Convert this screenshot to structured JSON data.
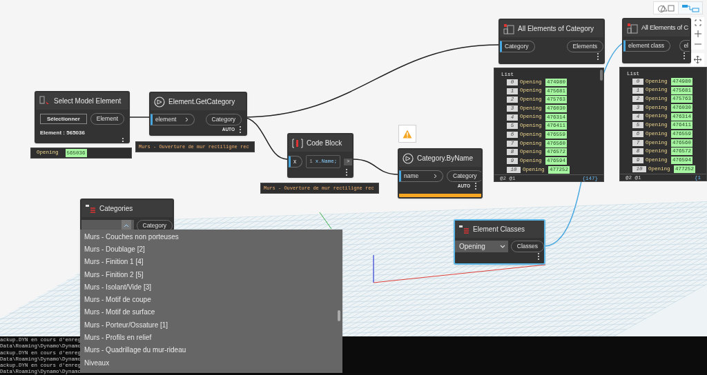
{
  "view_buttons": [
    {
      "kind": "geometry",
      "selected": false
    },
    {
      "kind": "graph",
      "selected": true
    }
  ],
  "nodes": [
    {
      "kind": "select",
      "title": "Select Model Element",
      "selected": false,
      "button": "Sélectionner",
      "outputs": [
        "Element"
      ],
      "info": "Element : 565036",
      "preview": {
        "kind": "item",
        "label": "Opening",
        "value": "565036"
      }
    },
    {
      "kind": "function",
      "title": "Element.GetCategory",
      "selected": false,
      "inputs": [
        "element"
      ],
      "outputs": [
        "Category"
      ],
      "lacing": "AUTO",
      "preview": {
        "kind": "text",
        "text": "Murs - Ouverture de mur rectiligne rec"
      }
    },
    {
      "kind": "code",
      "title": "Code Block",
      "selected": false,
      "inputs": [
        "x"
      ],
      "line": "1",
      "code": "x.Name;",
      "outputs": [
        ">"
      ],
      "preview": {
        "kind": "text",
        "text": "Murs - Ouverture de mur rectiligne rec"
      }
    },
    {
      "kind": "function",
      "title": "Category.ByName",
      "selected": false,
      "warning": true,
      "inputs": [
        "name"
      ],
      "outputs": [
        "Category"
      ],
      "lacing": "AUTO"
    },
    {
      "kind": "query",
      "title": "All Elements of Category",
      "selected": false,
      "inputs": [
        "Category"
      ],
      "outputs": [
        "Elements"
      ],
      "preview": {
        "kind": "list",
        "header": "List",
        "levels": "@2 @1",
        "count": "{147}",
        "rows": [
          {
            "index": "0",
            "label": "Opening",
            "value": "474980"
          },
          {
            "index": "1",
            "label": "Opening",
            "value": "475681"
          },
          {
            "index": "2",
            "label": "Opening",
            "value": "475763"
          },
          {
            "index": "3",
            "label": "Opening",
            "value": "476030"
          },
          {
            "index": "4",
            "label": "Opening",
            "value": "476314"
          },
          {
            "index": "5",
            "label": "Opening",
            "value": "476411"
          },
          {
            "index": "6",
            "label": "Opening",
            "value": "476559"
          },
          {
            "index": "7",
            "label": "Opening",
            "value": "476560"
          },
          {
            "index": "8",
            "label": "Opening",
            "value": "476572"
          },
          {
            "index": "9",
            "label": "Opening",
            "value": "476594"
          },
          {
            "index": "10",
            "label": "Opening",
            "value": "477252"
          }
        ]
      }
    },
    {
      "kind": "query",
      "title": "All Elements of C",
      "selected": false,
      "inputs": [
        "element class"
      ],
      "outputs": [
        "el"
      ],
      "preview": {
        "kind": "list",
        "header": "List",
        "levels": "@2 @1",
        "count": "{1",
        "rows": [
          {
            "index": "0",
            "label": "Opening",
            "value": "474980"
          },
          {
            "index": "1",
            "label": "Opening",
            "value": "475681"
          },
          {
            "index": "2",
            "label": "Opening",
            "value": "475763"
          },
          {
            "index": "3",
            "label": "Opening",
            "value": "476030"
          },
          {
            "index": "4",
            "label": "Opening",
            "value": "476314"
          },
          {
            "index": "5",
            "label": "Opening",
            "value": "476411"
          },
          {
            "index": "6",
            "label": "Opening",
            "value": "476559"
          },
          {
            "index": "7",
            "label": "Opening",
            "value": "476560"
          },
          {
            "index": "8",
            "label": "Opening",
            "value": "476572"
          },
          {
            "index": "9",
            "label": "Opening",
            "value": "476594"
          },
          {
            "index": "10",
            "label": "Opening",
            "value": "477252"
          }
        ]
      }
    },
    {
      "kind": "dropdown",
      "title": "Categories",
      "selected": false,
      "expanded": true,
      "outputs": [
        "Category"
      ],
      "options": [
        "Murs - Couches non porteuses",
        "Murs - Doublage [2]",
        "Murs - Finition 1 [4]",
        "Murs - Finition 2 [5]",
        "Murs - Isolant/Vide [3]",
        "Murs - Motif de coupe",
        "Murs - Motif de surface",
        "Murs - Porteur/Ossature [1]",
        "Murs - Profils en relief",
        "Murs - Quadrillage du mur-rideau",
        "Niveaux"
      ]
    },
    {
      "kind": "dropdown",
      "title": "Element Classes",
      "selected": true,
      "expanded": false,
      "value": "Opening",
      "outputs": [
        "Classes"
      ]
    }
  ],
  "console": [
    "ackup.DYN en cours d'enreg",
    "Data\\Roaming\\Dynamo\\Dynamo",
    "ackup.DYN en cours d'enreg",
    "Data\\Roaming\\Dynamo\\Dynamo",
    "ackup.DYN en cours d'enreg",
    "Data\\Roaming\\Dynamo\\Dynamo"
  ]
}
